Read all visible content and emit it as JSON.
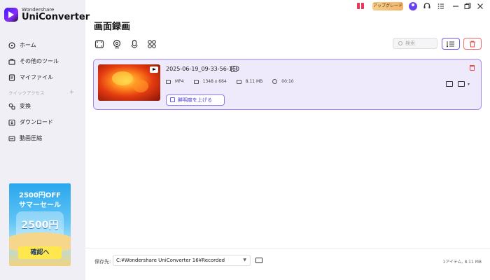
{
  "brand": {
    "sub": "Wondershare",
    "name": "UniConverter"
  },
  "sidebar": {
    "items": [
      {
        "label": "ホーム",
        "icon": "home-icon"
      },
      {
        "label": "その他のツール",
        "icon": "toolbox-icon"
      },
      {
        "label": "マイファイル",
        "icon": "files-icon"
      }
    ],
    "section_label": "クイックアクセス",
    "section_add": "+",
    "quick_items": [
      {
        "label": "変換",
        "icon": "convert-icon"
      },
      {
        "label": "ダウンロード",
        "icon": "download-icon"
      },
      {
        "label": "動画圧縮",
        "icon": "compress-icon"
      }
    ]
  },
  "promo": {
    "line1": "2500円OFF",
    "line2": "サマーセール",
    "badge": "2500円",
    "button": "確認へ"
  },
  "topbar": {
    "upgrade_label": "アップグレード",
    "icons": [
      "gift-icon",
      "avatar-icon",
      "headset-icon",
      "menu-icon",
      "minimize-icon",
      "restore-icon",
      "close-icon"
    ]
  },
  "main": {
    "title": "画面録画",
    "search_placeholder": "検索",
    "mode_icons": [
      "screen-record-icon",
      "webcam-icon",
      "audio-record-icon",
      "apps-grid-icon"
    ]
  },
  "file": {
    "name": "2025-06-19_09-33-56-160",
    "format": "MP4",
    "resolution": "1348 x 664",
    "size": "8.11 MB",
    "duration": "00:10",
    "enhance_label": "鮮明度を上げる"
  },
  "footer": {
    "save_label": "保存先:",
    "path": "C:¥Wondershare UniConverter 16¥Recorded",
    "count_info": "1アイテム, 8.11 MB"
  },
  "colors": {
    "accent": "#6a5af9",
    "card_bg": "#eee9fb",
    "danger": "#e64848"
  }
}
